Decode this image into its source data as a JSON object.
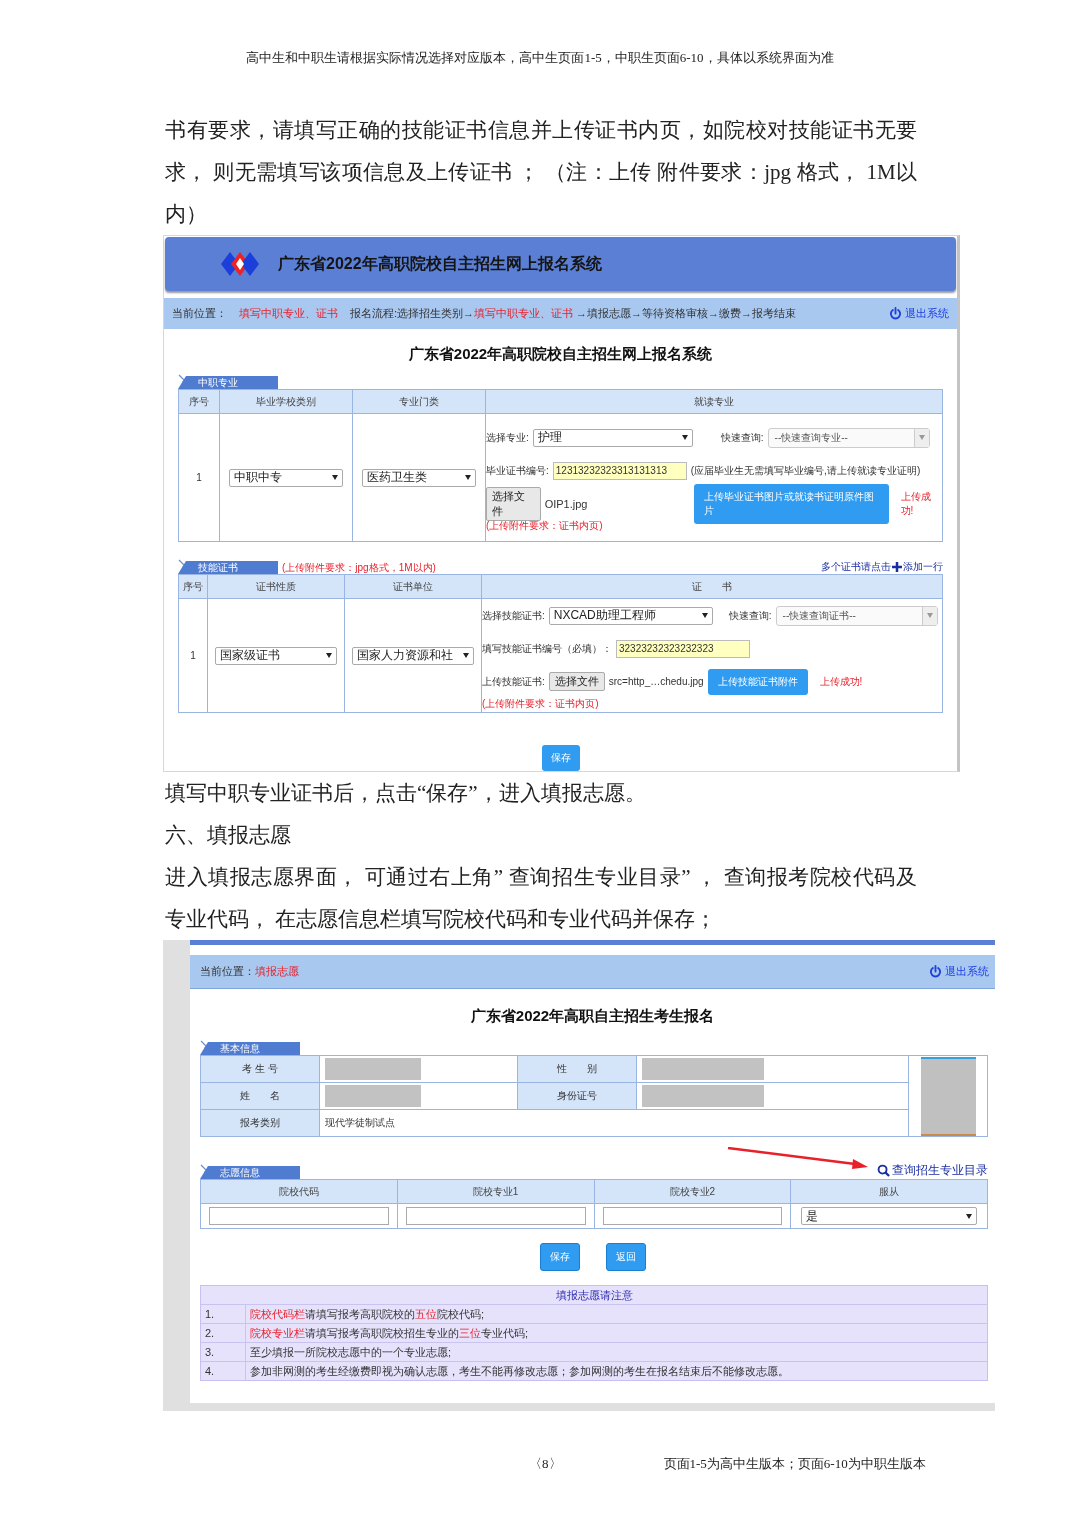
{
  "header_note": "高中生和中职生请根据实际情况选择对应版本，高中生页面1-5，中职生页面6-10，具体以系统界面为准",
  "intro_paragraph": "书有要求，请填写正确的技能证书信息并上传证书内页，如院校对技能证书无要求， 则无需填写该项信息及上传证书 ； （注：上传 附件要求：jpg 格式， 1M以内）",
  "screenshot_1": {
    "app_title": "广东省2022年高职院校自主招生网上报名系统",
    "breadcrumb": {
      "label": "当前位置：",
      "current": "填写中职专业、证书",
      "flow": [
        {
          "text": "报名流程:选择招生类别→",
          "highlight": false
        },
        {
          "text": "填写中职专业、证书",
          "highlight": true
        },
        {
          "text": " →填报志愿→等待资格审核→缴费→报考结束",
          "highlight": false
        }
      ]
    },
    "logout": "退出系统",
    "page_title": "广东省2022年高职院校自主招生网上报名系统",
    "major_section": {
      "tab": "中职专业",
      "columns": [
        "序号",
        "毕业学校类别",
        "专业门类",
        "就读专业"
      ],
      "row": {
        "index": "1",
        "school_type": "中职中专",
        "category": "医药卫生类",
        "major_label": "选择专业:",
        "major": "护理",
        "quick_search_label": "快速查询:",
        "quick_search_placeholder": "--快速查询专业--",
        "certificate_no_label": "毕业证书编号:",
        "certificate_no": "12313232323313131313",
        "certificate_no_note": "(应届毕业生无需填写毕业编号,请上传就读专业证明)",
        "choose_file_button": "选择文件",
        "file_name": "OIP1.jpg",
        "upload_button": "上传毕业证书图片或就读书证明原件图片",
        "upload_status": "上传成功!",
        "requirement": "(上传附件要求：证书内页)"
      }
    },
    "certificate_section": {
      "tab": "技能证书",
      "requirement": "(上传附件要求：jpg格式，1M以内)",
      "add_hint": "多个证书请点击",
      "add_link": "添加一行",
      "columns": [
        "序号",
        "证书性质",
        "证书单位",
        "证　　书"
      ],
      "row": {
        "index": "1",
        "cert_type": "国家级证书",
        "issuer": "国家人力资源和社",
        "certificate_label": "选择技能证书:",
        "certificate": "NXCAD助理工程师",
        "quick_search_label": "快速查询:",
        "quick_search_placeholder": "--快速查询证书--",
        "number_label": "填写技能证书编号（必填）：",
        "number": "32323232323232323",
        "upload_label": "上传技能证书:",
        "choose_file_button": "选择文件",
        "file_name": "src=http_…chedu.jpg",
        "upload_button": "上传技能证书附件",
        "upload_status": "上传成功!",
        "requirement": "(上传附件要求：证书内页)"
      }
    },
    "save_button": "保存"
  },
  "paragraphs": [
    "填写中职专业证书后，点击“保存”，进入填报志愿。",
    "六、填报志愿",
    "进入填报志愿界面， 可通过右上角” 查询招生专业目录” ， 查询报考院校代码及专业代码， 在志愿信息栏填写院校代码和专业代码并保存；"
  ],
  "screenshot_2": {
    "breadcrumb": {
      "label": "当前位置：",
      "current": "填报志愿"
    },
    "logout": "退出系统",
    "page_title": "广东省2022年高职自主招生考生报名",
    "basic_info": {
      "tab": "基本信息",
      "fields": [
        {
          "label": "考 生 号",
          "redacted": true
        },
        {
          "label": "性　　别",
          "redacted": true
        },
        {
          "label": "姓　　名",
          "redacted": true
        },
        {
          "label": "身份证号",
          "redacted": true
        }
      ],
      "category_label": "报考类别",
      "category": "现代学徒制试点"
    },
    "wishes": {
      "tab": "志愿信息",
      "catalog_link": "查询招生专业目录",
      "columns": [
        "院校代码",
        "院校专业1",
        "院校专业2",
        "服从"
      ],
      "obey": "是"
    },
    "buttons": [
      "保存",
      "返回"
    ],
    "notice": {
      "title": "填报志愿请注意",
      "items": [
        {
          "number": "1.",
          "segments": [
            {
              "text": "院校代码栏",
              "highlight": true
            },
            {
              "text": "请填写报考高职院校的",
              "highlight": false
            },
            {
              "text": "五位",
              "highlight": true
            },
            {
              "text": "院校代码;",
              "highlight": false
            }
          ]
        },
        {
          "number": "2.",
          "segments": [
            {
              "text": "院校专业栏",
              "highlight": true
            },
            {
              "text": "请填写报考高职院校招生专业的",
              "highlight": false
            },
            {
              "text": "三位",
              "highlight": true
            },
            {
              "text": "专业代码;",
              "highlight": false
            }
          ]
        },
        {
          "number": "3.",
          "segments": [
            {
              "text": "至少填报一所院校志愿中的一个专业志愿;",
              "highlight": false
            }
          ]
        },
        {
          "number": "4.",
          "segments": [
            {
              "text": "参加非网测的考生经缴费即视为确认志愿，考生不能再修改志愿；参加网测的考生在报名结束后不能修改志愿。",
              "highlight": false
            }
          ]
        }
      ]
    }
  },
  "footer": {
    "page_number": "〈8〉",
    "note": "页面1-5为高中生版本；页面6-10为中职生版本"
  }
}
